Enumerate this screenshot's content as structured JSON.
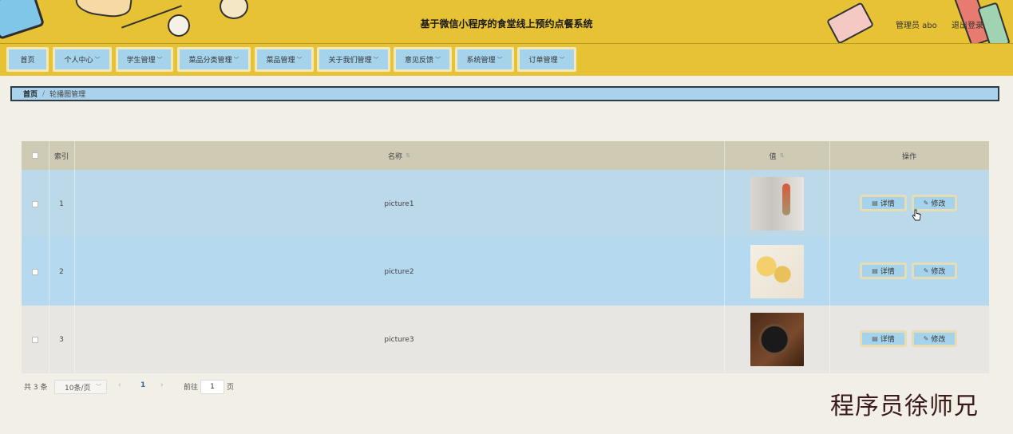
{
  "header": {
    "title": "基于微信小程序的食堂线上预约点餐系统",
    "admin_label": "管理员 abo",
    "logout_label": "退出登录",
    "bg_color": "#e7c234"
  },
  "nav": {
    "items": [
      {
        "label": "首页",
        "has_dropdown": false
      },
      {
        "label": "个人中心",
        "has_dropdown": true
      },
      {
        "label": "学生管理",
        "has_dropdown": true
      },
      {
        "label": "菜品分类管理",
        "has_dropdown": true
      },
      {
        "label": "菜品管理",
        "has_dropdown": true
      },
      {
        "label": "关于我们管理",
        "has_dropdown": true
      },
      {
        "label": "意见反馈",
        "has_dropdown": true
      },
      {
        "label": "系统管理",
        "has_dropdown": true
      },
      {
        "label": "订单管理",
        "has_dropdown": true
      }
    ],
    "chevron_icon": "chevron-down-icon"
  },
  "breadcrumb": {
    "home": "首页",
    "separator": "/",
    "current": "轮播图管理"
  },
  "table": {
    "columns": {
      "index": "索引",
      "name": "名称",
      "value": "值",
      "actions": "操作"
    },
    "rows": [
      {
        "index": "1",
        "name": "picture1",
        "image": "thumbnail-1"
      },
      {
        "index": "2",
        "name": "picture2",
        "image": "thumbnail-2"
      },
      {
        "index": "3",
        "name": "picture3",
        "image": "thumbnail-3"
      }
    ],
    "detail_label": "详情",
    "edit_label": "修改",
    "detail_icon": "document-icon",
    "edit_icon": "pencil-icon"
  },
  "pagination": {
    "total": "共 3 条",
    "page_size": "10条/页",
    "prev": "‹",
    "current_page": "1",
    "next": "›",
    "goto_label": "前往",
    "goto_value": "1",
    "page_suffix": "页"
  },
  "watermark": "程序员徐师兄"
}
